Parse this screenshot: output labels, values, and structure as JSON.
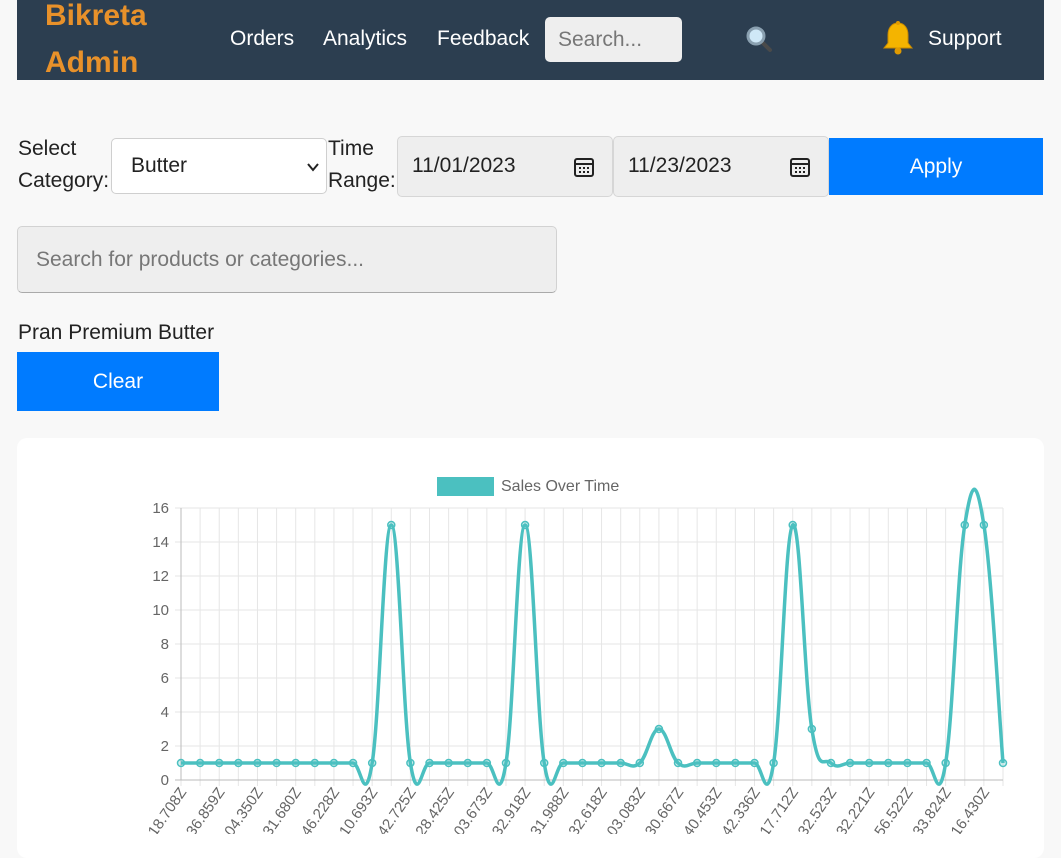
{
  "nav": {
    "brand_line1": "Bikreta",
    "brand_line2": "Admin",
    "links": [
      "Orders",
      "Analytics",
      "Feedback"
    ],
    "search_placeholder": "Search...",
    "support_label": "Support"
  },
  "filters": {
    "category_label_line1": "Select",
    "category_label_line2": "Category:",
    "category_value": "Butter",
    "time_label_line1": "Time",
    "time_label_line2": "Range:",
    "start_date": "11/01/2023",
    "end_date": "11/23/2023",
    "apply_label": "Apply"
  },
  "product_search": {
    "placeholder": "Search for products or categories..."
  },
  "selected_product": "Pran Premium Butter",
  "clear_label": "Clear",
  "colors": {
    "navbar": "#2c3e50",
    "brand": "#e8912a",
    "primary_button": "#007bff",
    "series_line": "#4bc0c0"
  },
  "icons": {
    "search": "magnifier-icon",
    "notifications": "bell-icon",
    "calendar": "calendar-icon"
  },
  "chart_data": {
    "type": "line",
    "legend": "Sales Over Time",
    "legend_position": "top",
    "grid": true,
    "ylim": [
      0,
      16
    ],
    "yticks": [
      0,
      2,
      4,
      6,
      8,
      10,
      12,
      14,
      16
    ],
    "x_tick_labels": [
      "18.708Z",
      "36.859Z",
      "04.350Z",
      "31.680Z",
      "46.228Z",
      "10.693Z",
      "42.725Z",
      "28.425Z",
      "03.673Z",
      "32.918Z",
      "31.988Z",
      "32.618Z",
      "03.083Z",
      "30.667Z",
      "40.453Z",
      "42.336Z",
      "17.712Z",
      "32.523Z",
      "32.221Z",
      "56.522Z",
      "33.824Z",
      "16.430Z"
    ],
    "series": [
      {
        "name": "Sales Over Time",
        "values": [
          1,
          1,
          1,
          1,
          1,
          1,
          1,
          1,
          1,
          1,
          1,
          15,
          1,
          1,
          1,
          1,
          1,
          1,
          15,
          1,
          1,
          1,
          1,
          1,
          1,
          3,
          1,
          1,
          1,
          1,
          1,
          1,
          15,
          3,
          1,
          1,
          1,
          1,
          1,
          1,
          1,
          15,
          15,
          1
        ]
      }
    ]
  }
}
